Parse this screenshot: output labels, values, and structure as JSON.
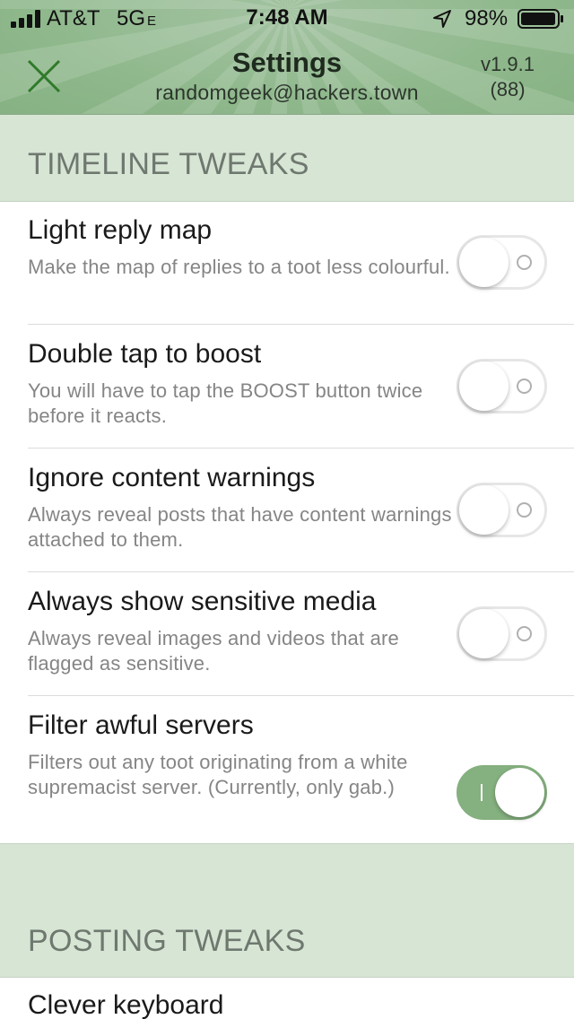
{
  "status_bar": {
    "carrier": "AT&T",
    "network": "5G",
    "network_suffix": "E",
    "time": "7:48 AM",
    "battery": "98%"
  },
  "header": {
    "title": "Settings",
    "account": "randomgeek@hackers.town",
    "version": "v1.9.1",
    "build": "(88)"
  },
  "icons": {
    "close": "close-icon",
    "signal": "signal-bars-icon",
    "location": "location-arrow-icon",
    "battery": "battery-icon"
  },
  "colors": {
    "accent": "#85b07f",
    "header_bg": "#8fb88c",
    "section_bg": "#d6e5d4",
    "close_icon": "#2f7a2a"
  },
  "sections": [
    {
      "title": "TIMELINE TWEAKS",
      "items": [
        {
          "label": "Light reply map",
          "description": "Make the map of replies to a toot less colourful.",
          "enabled": false
        },
        {
          "label": "Double tap to boost",
          "description": "You will have to tap the BOOST button twice before it reacts.",
          "enabled": false
        },
        {
          "label": "Ignore content warnings",
          "description": "Always reveal posts that have content warnings attached to them.",
          "enabled": false
        },
        {
          "label": "Always show sensitive media",
          "description": "Always reveal images and videos that are flagged as sensitive.",
          "enabled": false
        },
        {
          "label": "Filter awful servers",
          "description": "Filters out any toot originating from a white supremacist server. (Currently, only gab.)",
          "enabled": true
        }
      ]
    },
    {
      "title": "POSTING TWEAKS",
      "items": [
        {
          "label": "Clever keyboard"
        }
      ]
    }
  ]
}
